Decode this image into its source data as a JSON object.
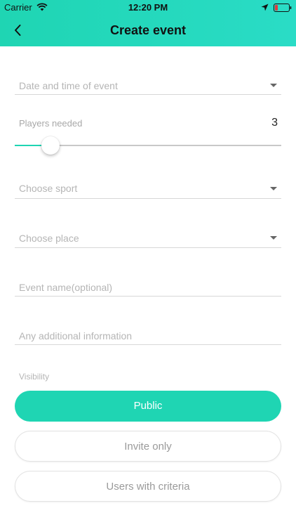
{
  "status_bar": {
    "carrier": "Carrier",
    "time": "12:20 PM",
    "battery_color": "#e0393e"
  },
  "header": {
    "title": "Create event",
    "back_icon": "chevron-left-icon",
    "color": "#1fd5b3"
  },
  "form": {
    "date_time": {
      "placeholder": "Date and time of event",
      "icon": "caret-down-icon"
    },
    "players": {
      "label": "Players needed",
      "value": "3",
      "slider_fraction": 0.135
    },
    "sport": {
      "placeholder": "Choose sport",
      "icon": "caret-down-icon"
    },
    "place": {
      "placeholder": "Choose place",
      "icon": "caret-down-icon"
    },
    "event_name": {
      "placeholder": "Event name(optional)"
    },
    "additional_info": {
      "placeholder": "Any additional information"
    }
  },
  "visibility": {
    "label": "Visibility",
    "options": [
      {
        "label": "Public",
        "selected": true
      },
      {
        "label": "Invite only",
        "selected": false
      },
      {
        "label": "Users with criteria",
        "selected": false
      }
    ],
    "accent_color": "#1fd5b3"
  }
}
